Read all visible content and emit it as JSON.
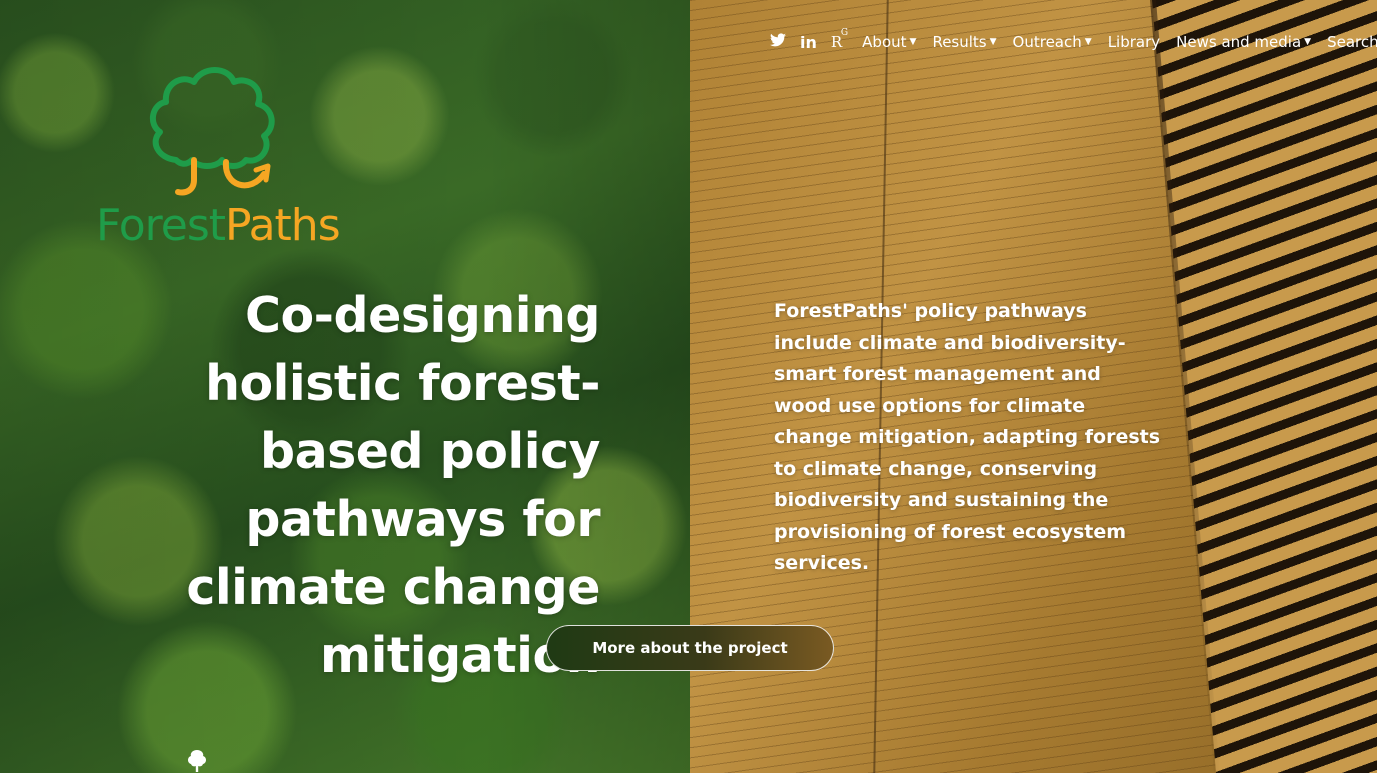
{
  "brand": {
    "name_part1": "Forest",
    "name_part2": "Paths",
    "green": "#1f9c49",
    "orange": "#f5a623"
  },
  "nav": {
    "social": [
      "twitter-icon",
      "linkedin-icon",
      "researchgate-icon"
    ],
    "researchgate_label": "R",
    "researchgate_sup": "G",
    "items": [
      {
        "label": "About",
        "dropdown": true
      },
      {
        "label": "Results",
        "dropdown": true
      },
      {
        "label": "Outreach",
        "dropdown": true
      },
      {
        "label": "Library",
        "dropdown": false
      },
      {
        "label": "News and media",
        "dropdown": true
      }
    ],
    "search_label": "Search"
  },
  "hero": {
    "headline": "Co-designing holistic forest-based policy pathways for climate change mitigation",
    "lead": "ForestPaths' policy pathways include climate and biodiversity-smart forest management and wood use options for climate change mitigation, adapting forests to climate change, conserving biodiversity and sustaining the provisioning of forest ecosystem services.",
    "cta_label": "More about the project"
  }
}
